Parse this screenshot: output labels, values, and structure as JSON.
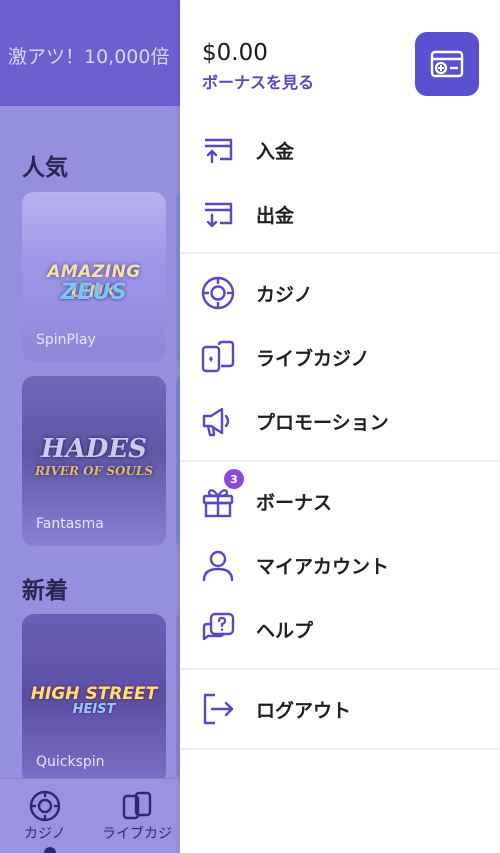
{
  "promo": {
    "text": "激アツ！10,000倍"
  },
  "sections": {
    "popular": "人気",
    "new": "新着"
  },
  "games": [
    {
      "logo1": "AMAZING LINK",
      "logo2": "ZEUS",
      "provider": "SpinPlay"
    },
    {
      "logo1": "HADES",
      "logo2": "RIVER OF SOULS",
      "provider": "Fantasma"
    },
    {
      "logo1": "HIGH STREET",
      "logo2": "HEIST",
      "provider": "Quickspin"
    }
  ],
  "bottom_nav": {
    "casino": "カジノ",
    "live_casino": "ライブカジ"
  },
  "drawer": {
    "balance": "$0.00",
    "bonus_link": "ボーナスを見る",
    "items": {
      "deposit": "入金",
      "withdraw": "出金",
      "casino": "カジノ",
      "live_casino": "ライブカジノ",
      "promotions": "プロモーション",
      "bonus": "ボーナス",
      "bonus_badge": "3",
      "my_account": "マイアカウント",
      "help": "ヘルプ",
      "logout": "ログアウト"
    }
  },
  "colors": {
    "accent": "#5b4fd1",
    "icon": "#5648c7",
    "badge": "#8c4bd6",
    "overlay": "#9590dd"
  }
}
